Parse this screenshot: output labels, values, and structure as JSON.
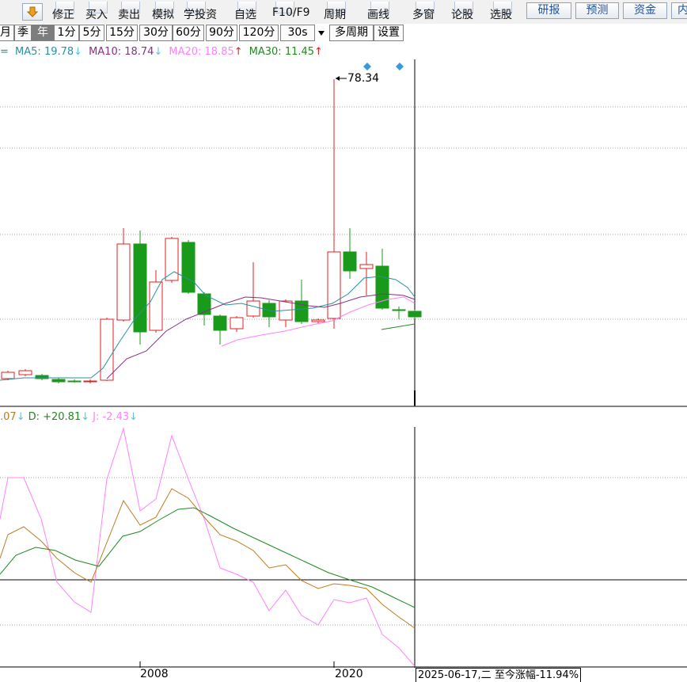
{
  "toolbar": {
    "down_arrow_icon": "down-arrow-icon",
    "items": [
      {
        "label": "修正",
        "name": "revise"
      },
      {
        "label": "买入",
        "name": "buy"
      },
      {
        "label": "卖出",
        "name": "sell"
      },
      {
        "label": "模拟",
        "name": "simulate"
      },
      {
        "label": "学投资",
        "name": "learn-invest"
      },
      {
        "label": "自选",
        "name": "watchlist"
      },
      {
        "label": "F10/F9",
        "name": "f10-f9"
      },
      {
        "label": "周期",
        "name": "period"
      },
      {
        "label": "画线",
        "name": "draw-line"
      },
      {
        "label": "多窗",
        "name": "multi-window"
      },
      {
        "label": "论股",
        "name": "discuss-stock"
      },
      {
        "label": "选股",
        "name": "stock-picker"
      }
    ],
    "buttons": [
      {
        "label": "研报",
        "name": "research-report"
      },
      {
        "label": "预测",
        "name": "forecast"
      },
      {
        "label": "资金",
        "name": "capital-flow"
      },
      {
        "label": "内",
        "name": "more"
      }
    ]
  },
  "period_bar": {
    "items": [
      "月",
      "季",
      "年",
      "1分",
      "5分",
      "15分",
      "30分",
      "60分",
      "90分",
      "120分",
      "30s"
    ],
    "active": "年",
    "extra": [
      "多周期",
      "设置"
    ]
  },
  "ma_legend": {
    "prefix": "=",
    "items": [
      {
        "text": "MA5: 19.78",
        "arrow": "↓",
        "color": "#2a8fa0",
        "arrow_color": "#5bc0de"
      },
      {
        "text": "MA10: 18.74",
        "arrow": "↓",
        "color": "#8a2e86",
        "arrow_color": "#5bc0de"
      },
      {
        "text": "MA20: 18.85",
        "arrow": "↑",
        "color": "#ff80ff",
        "arrow_color": "#e02020"
      },
      {
        "text": "MA30: 11.45",
        "arrow": "↑",
        "color": "#1f8a1f",
        "arrow_color": "#e02020"
      }
    ]
  },
  "max_label": "78.34",
  "kdj_legend": {
    "items": [
      {
        "text": ".07",
        "arrow": "↓",
        "color": "#c07a20",
        "arrow_color": "#5bc0de"
      },
      {
        "text": "D: +20.81",
        "arrow": "↓",
        "color": "#1f8a1f",
        "arrow_color": "#5bc0de"
      },
      {
        "text": "J: -2.43",
        "arrow": "↓",
        "color": "#ff80ff",
        "arrow_color": "#5bc0de"
      }
    ]
  },
  "x_axis": {
    "years": [
      "2008",
      "2020"
    ]
  },
  "status_text": "2025-06-17,二 至今涨幅-11.94%",
  "colors": {
    "up": "#e02020",
    "down": "#1a9a1a",
    "grid": "#a0a0a0",
    "axis": "#000000"
  }
}
